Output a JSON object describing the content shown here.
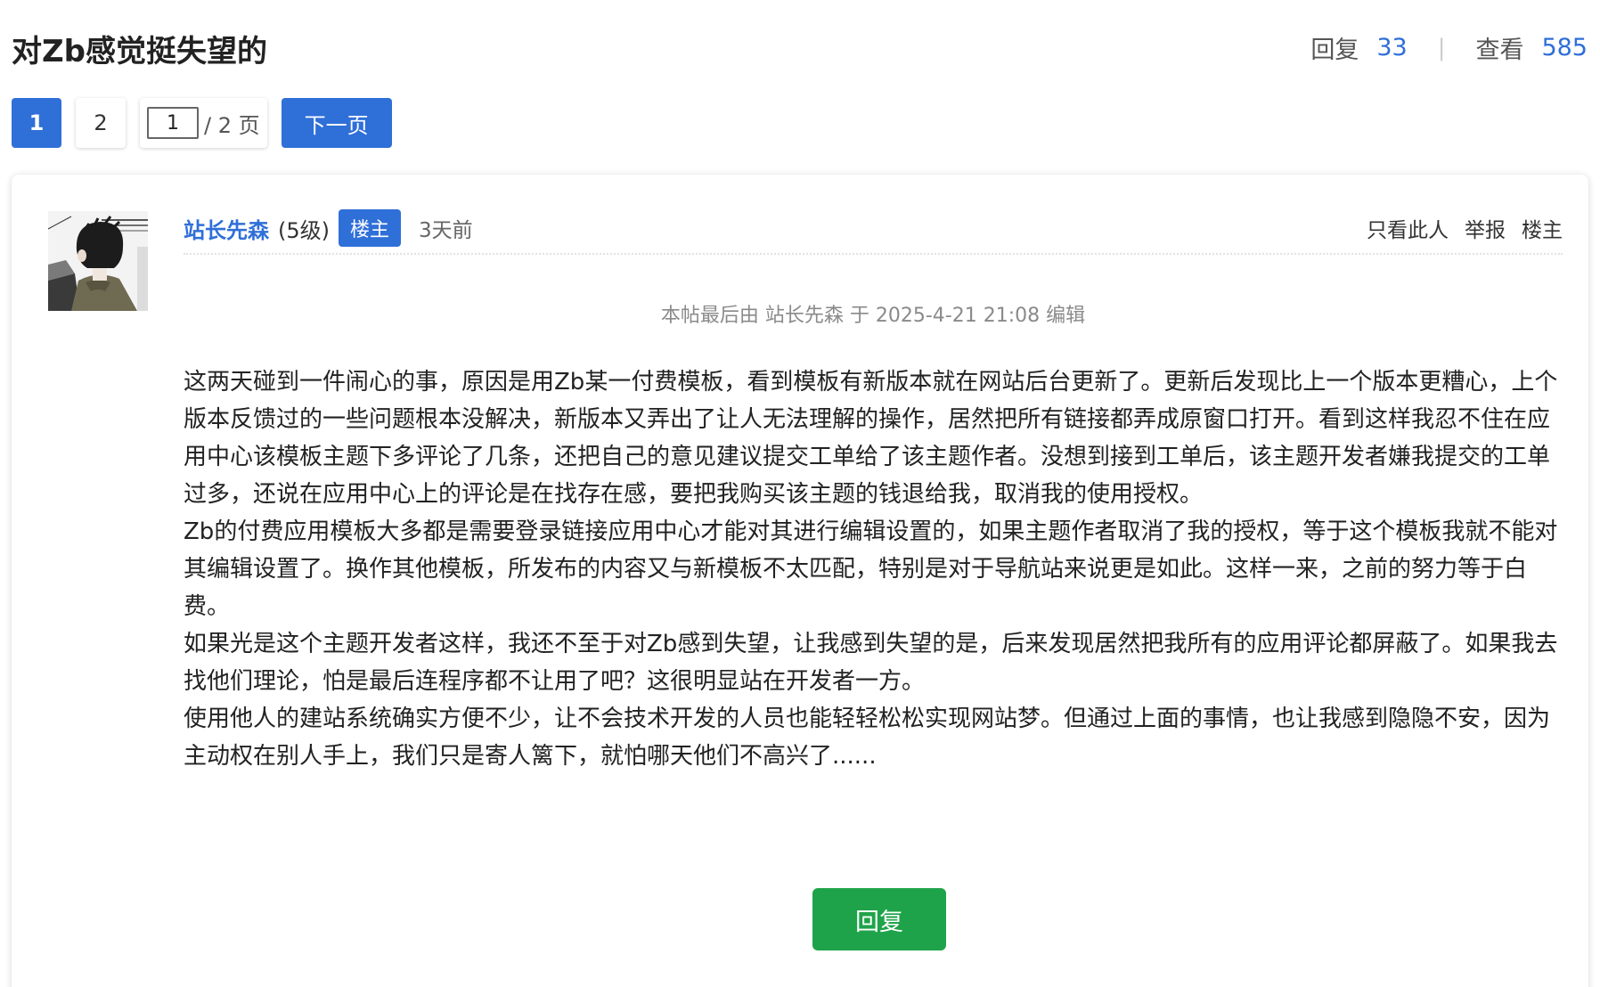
{
  "thread": {
    "title": "对Zb感觉挺失望的",
    "reply_label": "回复",
    "reply_count": "33",
    "view_label": "查看",
    "view_count": "585"
  },
  "pagination": {
    "pages": [
      "1",
      "2"
    ],
    "current_value": "1",
    "total_label": "/ 2 页",
    "next_label": "下一页"
  },
  "post": {
    "author": "站长先森",
    "level": "(5级)",
    "badge": "楼主",
    "time": "3天前",
    "actions": [
      "只看此人",
      "举报",
      "楼主"
    ],
    "edit_note": "本帖最后由 站长先森 于 2025-4-21 21:08 编辑",
    "paragraphs": [
      "这两天碰到一件闹心的事，原因是用Zb某一付费模板，看到模板有新版本就在网站后台更新了。更新后发现比上一个版本更糟心，上个版本反馈过的一些问题根本没解决，新版本又弄出了让人无法理解的操作，居然把所有链接都弄成原窗口打开。看到这样我忍不住在应用中心该模板主题下多评论了几条，还把自己的意见建议提交工单给了该主题作者。没想到接到工单后，该主题开发者嫌我提交的工单过多，还说在应用中心上的评论是在找存在感，要把我购买该主题的钱退给我，取消我的使用授权。",
      "Zb的付费应用模板大多都是需要登录链接应用中心才能对其进行编辑设置的，如果主题作者取消了我的授权，等于这个模板我就不能对其编辑设置了。换作其他模板，所发布的内容又与新模板不太匹配，特别是对于导航站来说更是如此。这样一来，之前的努力等于白费。",
      "如果光是这个主题开发者这样，我还不至于对Zb感到失望，让我感到失望的是，后来发现居然把我所有的应用评论都屏蔽了。如果我去找他们理论，怕是最后连程序都不让用了吧？这很明显站在开发者一方。",
      "使用他人的建站系统确实方便不少，让不会技术开发的人员也能轻轻松松实现网站梦。但通过上面的事情，也让我感到隐隐不安，因为主动权在别人手上，我们只是寄人篱下，就怕哪天他们不高兴了......"
    ],
    "reply_button": "回复"
  },
  "colors": {
    "accent": "#2f6fd8",
    "reply_green": "#1fa34a"
  }
}
